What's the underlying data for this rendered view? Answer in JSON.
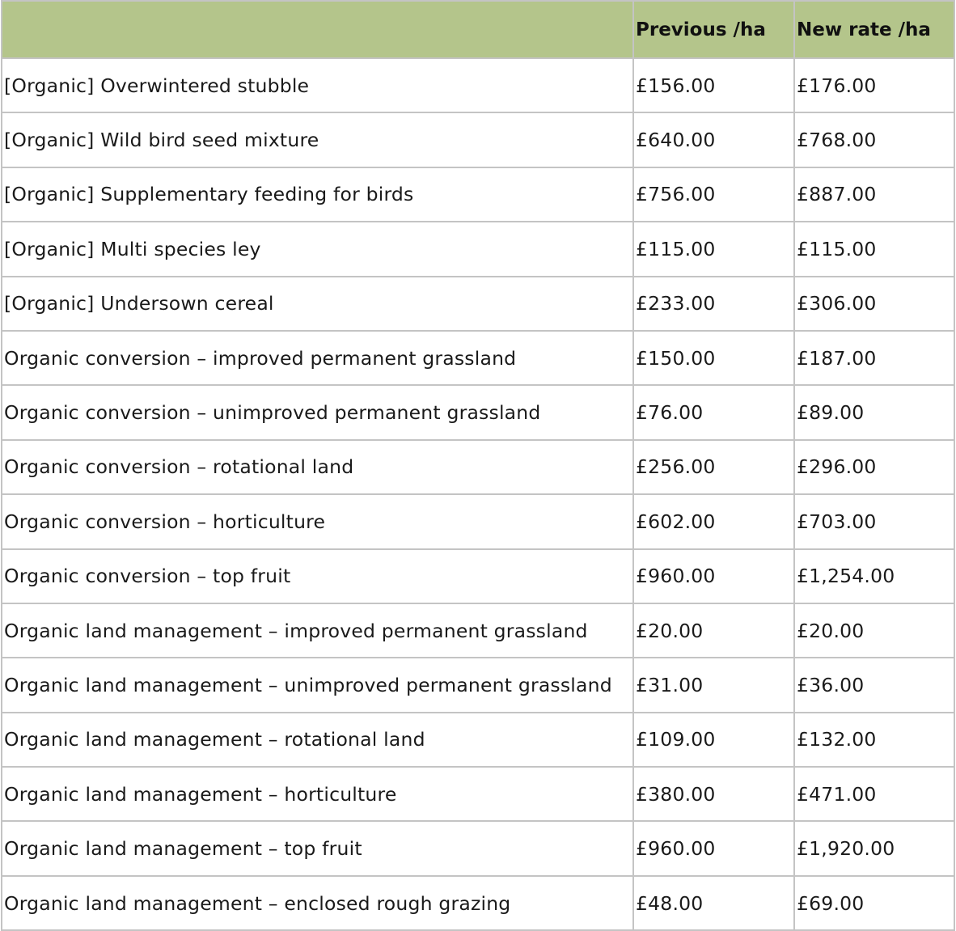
{
  "table": {
    "headers": [
      "",
      "Previous /ha",
      "New rate /ha"
    ],
    "header_color": "#b4c58b",
    "rows": [
      {
        "option": "[Organic] Overwintered stubble",
        "previous": "£156.00",
        "new": "£176.00"
      },
      {
        "option": "[Organic] Wild bird seed mixture",
        "previous": "£640.00",
        "new": "£768.00"
      },
      {
        "option": "[Organic] Supplementary feeding for birds",
        "previous": "£756.00",
        "new": "£887.00"
      },
      {
        "option": "[Organic] Multi species ley",
        "previous": "£115.00",
        "new": "£115.00"
      },
      {
        "option": "[Organic] Undersown cereal",
        "previous": "£233.00",
        "new": "£306.00"
      },
      {
        "option": "Organic conversion – improved permanent grassland",
        "previous": "£150.00",
        "new": "£187.00"
      },
      {
        "option": "Organic conversion – unimproved permanent grassland",
        "previous": "£76.00",
        "new": "£89.00"
      },
      {
        "option": "Organic conversion – rotational land",
        "previous": "£256.00",
        "new": "£296.00"
      },
      {
        "option": "Organic conversion – horticulture",
        "previous": "£602.00",
        "new": "£703.00"
      },
      {
        "option": "Organic conversion – top fruit",
        "previous": "£960.00",
        "new": "£1,254.00"
      },
      {
        "option": "Organic land management – improved permanent grassland",
        "previous": "£20.00",
        "new": "£20.00"
      },
      {
        "option": "Organic land management – unimproved permanent grassland",
        "previous": "£31.00",
        "new": "£36.00"
      },
      {
        "option": "Organic land management – rotational land",
        "previous": "£109.00",
        "new": "£132.00"
      },
      {
        "option": "Organic land management – horticulture",
        "previous": "£380.00",
        "new": "£471.00"
      },
      {
        "option": "Organic land management – top fruit",
        "previous": "£960.00",
        "new": "£1,920.00"
      },
      {
        "option": "Organic land management – enclosed rough grazing",
        "previous": "£48.00",
        "new": "£69.00"
      }
    ]
  }
}
